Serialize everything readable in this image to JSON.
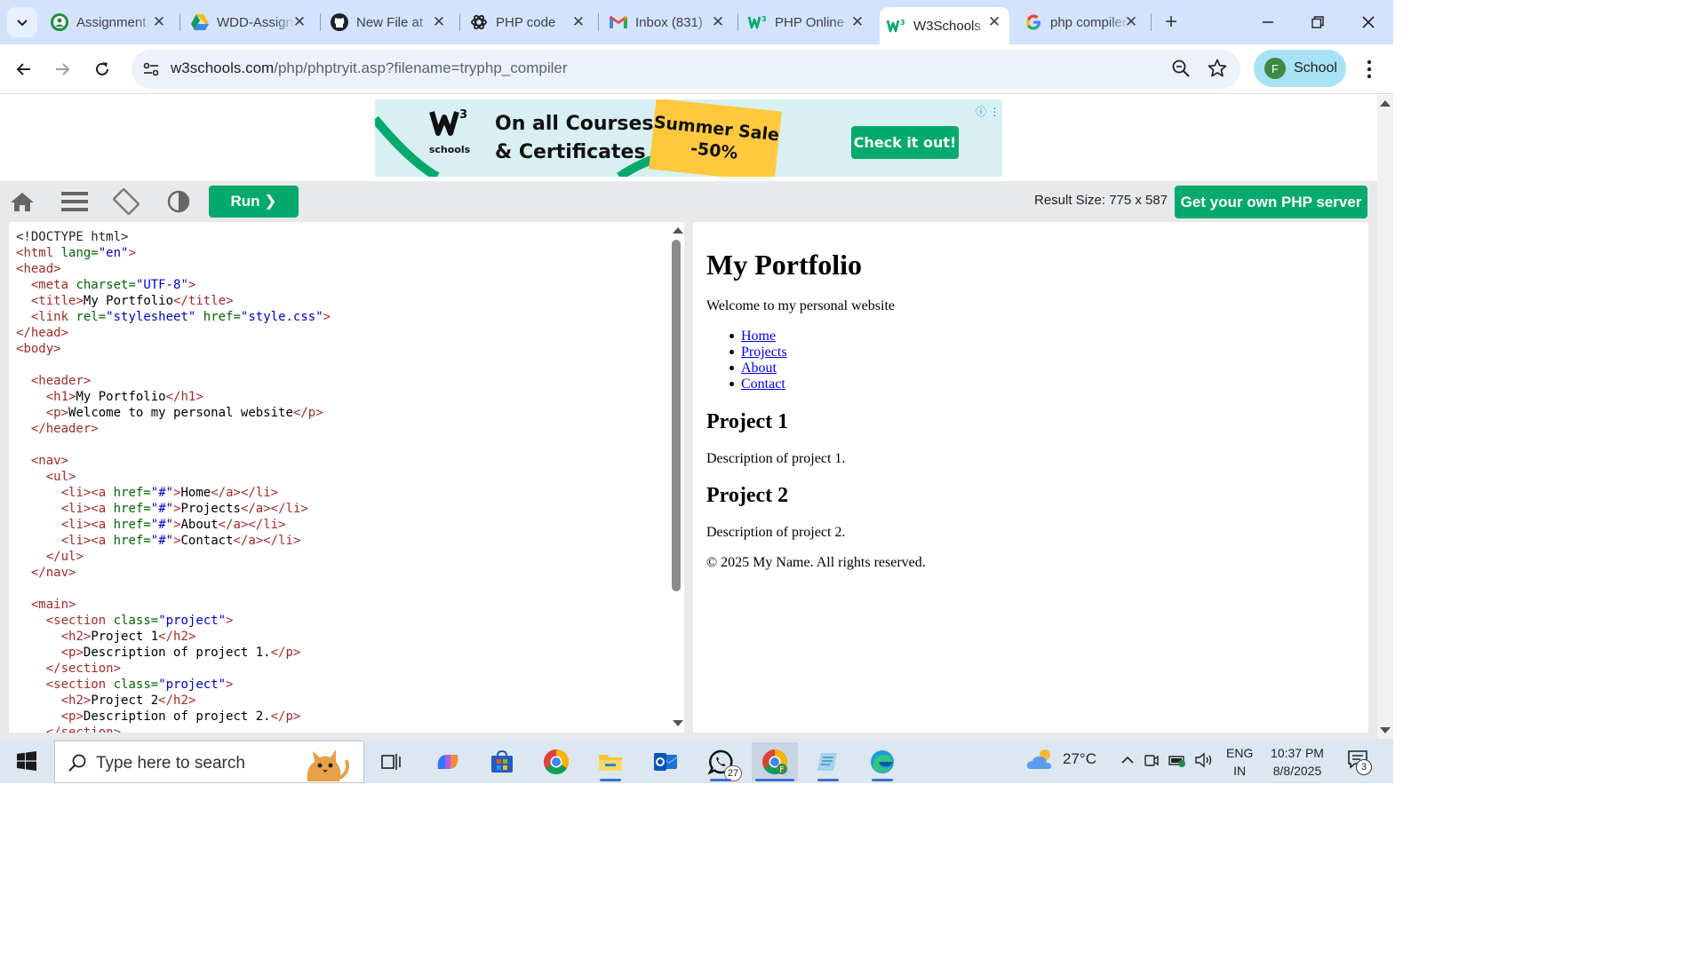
{
  "browser": {
    "tabs": [
      {
        "title": "Assignment",
        "icon": "classroom-icon"
      },
      {
        "title": "WDD-Assignment",
        "icon": "google-drive-icon"
      },
      {
        "title": "New File at",
        "icon": "github-icon"
      },
      {
        "title": "PHP code",
        "icon": "chatgpt-icon"
      },
      {
        "title": "Inbox (831)",
        "icon": "gmail-icon"
      },
      {
        "title": "PHP Online",
        "icon": "w3schools-icon"
      },
      {
        "title": "W3Schools",
        "icon": "w3schools-icon",
        "active": true
      },
      {
        "title": "php compiler",
        "icon": "google-icon"
      }
    ],
    "url_host": "w3schools.com",
    "url_path": "/php/phptryit.asp?filename=tryphp_compiler",
    "profile_initial": "F",
    "profile_name": "School"
  },
  "ad": {
    "logo_text": "schools",
    "logo_sup": "3",
    "headline_line1": "On all Courses",
    "headline_line2": "& Certificates",
    "sale_line1": "Summer Sale",
    "sale_line2": "-50%",
    "cta": "Check it out!"
  },
  "editor_toolbar": {
    "run_label": "Run ❯",
    "result_size": "Result Size: 775 x 587",
    "server_button": "Get your own PHP server"
  },
  "code_lines": [
    [
      [
        "doctype",
        "<!DOCTYPE html>"
      ]
    ],
    [
      [
        "bracket",
        "<"
      ],
      [
        "tag",
        "html"
      ],
      [
        "text",
        " "
      ],
      [
        "attr",
        "lang="
      ],
      [
        "str",
        "\"en\""
      ],
      [
        "bracket",
        ">"
      ]
    ],
    [
      [
        "bracket",
        "<"
      ],
      [
        "tag",
        "head"
      ],
      [
        "bracket",
        ">"
      ]
    ],
    [
      [
        "text",
        "  "
      ],
      [
        "bracket",
        "<"
      ],
      [
        "tag",
        "meta"
      ],
      [
        "text",
        " "
      ],
      [
        "attr",
        "charset="
      ],
      [
        "str",
        "\"UTF-8\""
      ],
      [
        "bracket",
        ">"
      ]
    ],
    [
      [
        "text",
        "  "
      ],
      [
        "bracket",
        "<"
      ],
      [
        "tag",
        "title"
      ],
      [
        "bracket",
        ">"
      ],
      [
        "text",
        "My Portfolio"
      ],
      [
        "bracket",
        "</"
      ],
      [
        "tag",
        "title"
      ],
      [
        "bracket",
        ">"
      ]
    ],
    [
      [
        "text",
        "  "
      ],
      [
        "bracket",
        "<"
      ],
      [
        "tag",
        "link"
      ],
      [
        "text",
        " "
      ],
      [
        "attr",
        "rel="
      ],
      [
        "str",
        "\"stylesheet\""
      ],
      [
        "text",
        " "
      ],
      [
        "attr",
        "href="
      ],
      [
        "str",
        "\"style.css\""
      ],
      [
        "bracket",
        ">"
      ]
    ],
    [
      [
        "bracket",
        "</"
      ],
      [
        "tag",
        "head"
      ],
      [
        "bracket",
        ">"
      ]
    ],
    [
      [
        "bracket",
        "<"
      ],
      [
        "tag",
        "body"
      ],
      [
        "bracket",
        ">"
      ]
    ],
    [],
    [
      [
        "text",
        "  "
      ],
      [
        "bracket",
        "<"
      ],
      [
        "tag",
        "header"
      ],
      [
        "bracket",
        ">"
      ]
    ],
    [
      [
        "text",
        "    "
      ],
      [
        "bracket",
        "<"
      ],
      [
        "tag",
        "h1"
      ],
      [
        "bracket",
        ">"
      ],
      [
        "text",
        "My Portfolio"
      ],
      [
        "bracket",
        "</"
      ],
      [
        "tag",
        "h1"
      ],
      [
        "bracket",
        ">"
      ]
    ],
    [
      [
        "text",
        "    "
      ],
      [
        "bracket",
        "<"
      ],
      [
        "tag",
        "p"
      ],
      [
        "bracket",
        ">"
      ],
      [
        "text",
        "Welcome to my personal website"
      ],
      [
        "bracket",
        "</"
      ],
      [
        "tag",
        "p"
      ],
      [
        "bracket",
        ">"
      ]
    ],
    [
      [
        "text",
        "  "
      ],
      [
        "bracket",
        "</"
      ],
      [
        "tag",
        "header"
      ],
      [
        "bracket",
        ">"
      ]
    ],
    [],
    [
      [
        "text",
        "  "
      ],
      [
        "bracket",
        "<"
      ],
      [
        "tag",
        "nav"
      ],
      [
        "bracket",
        ">"
      ]
    ],
    [
      [
        "text",
        "    "
      ],
      [
        "bracket",
        "<"
      ],
      [
        "tag",
        "ul"
      ],
      [
        "bracket",
        ">"
      ]
    ],
    [
      [
        "text",
        "      "
      ],
      [
        "bracket",
        "<"
      ],
      [
        "tag",
        "li"
      ],
      [
        "bracket",
        "><"
      ],
      [
        "tag",
        "a"
      ],
      [
        "text",
        " "
      ],
      [
        "attr",
        "href="
      ],
      [
        "str",
        "\"#\""
      ],
      [
        "bracket",
        ">"
      ],
      [
        "text",
        "Home"
      ],
      [
        "bracket",
        "</"
      ],
      [
        "tag",
        "a"
      ],
      [
        "bracket",
        "></"
      ],
      [
        "tag",
        "li"
      ],
      [
        "bracket",
        ">"
      ]
    ],
    [
      [
        "text",
        "      "
      ],
      [
        "bracket",
        "<"
      ],
      [
        "tag",
        "li"
      ],
      [
        "bracket",
        "><"
      ],
      [
        "tag",
        "a"
      ],
      [
        "text",
        " "
      ],
      [
        "attr",
        "href="
      ],
      [
        "str",
        "\"#\""
      ],
      [
        "bracket",
        ">"
      ],
      [
        "text",
        "Projects"
      ],
      [
        "bracket",
        "</"
      ],
      [
        "tag",
        "a"
      ],
      [
        "bracket",
        "></"
      ],
      [
        "tag",
        "li"
      ],
      [
        "bracket",
        ">"
      ]
    ],
    [
      [
        "text",
        "      "
      ],
      [
        "bracket",
        "<"
      ],
      [
        "tag",
        "li"
      ],
      [
        "bracket",
        "><"
      ],
      [
        "tag",
        "a"
      ],
      [
        "text",
        " "
      ],
      [
        "attr",
        "href="
      ],
      [
        "str",
        "\"#\""
      ],
      [
        "bracket",
        ">"
      ],
      [
        "text",
        "About"
      ],
      [
        "bracket",
        "</"
      ],
      [
        "tag",
        "a"
      ],
      [
        "bracket",
        "></"
      ],
      [
        "tag",
        "li"
      ],
      [
        "bracket",
        ">"
      ]
    ],
    [
      [
        "text",
        "      "
      ],
      [
        "bracket",
        "<"
      ],
      [
        "tag",
        "li"
      ],
      [
        "bracket",
        "><"
      ],
      [
        "tag",
        "a"
      ],
      [
        "text",
        " "
      ],
      [
        "attr",
        "href="
      ],
      [
        "str",
        "\"#\""
      ],
      [
        "bracket",
        ">"
      ],
      [
        "text",
        "Contact"
      ],
      [
        "bracket",
        "</"
      ],
      [
        "tag",
        "a"
      ],
      [
        "bracket",
        "></"
      ],
      [
        "tag",
        "li"
      ],
      [
        "bracket",
        ">"
      ]
    ],
    [
      [
        "text",
        "    "
      ],
      [
        "bracket",
        "</"
      ],
      [
        "tag",
        "ul"
      ],
      [
        "bracket",
        ">"
      ]
    ],
    [
      [
        "text",
        "  "
      ],
      [
        "bracket",
        "</"
      ],
      [
        "tag",
        "nav"
      ],
      [
        "bracket",
        ">"
      ]
    ],
    [],
    [
      [
        "text",
        "  "
      ],
      [
        "bracket",
        "<"
      ],
      [
        "tag",
        "main"
      ],
      [
        "bracket",
        ">"
      ]
    ],
    [
      [
        "text",
        "    "
      ],
      [
        "bracket",
        "<"
      ],
      [
        "tag",
        "section"
      ],
      [
        "text",
        " "
      ],
      [
        "attr",
        "class="
      ],
      [
        "str",
        "\"project\""
      ],
      [
        "bracket",
        ">"
      ]
    ],
    [
      [
        "text",
        "      "
      ],
      [
        "bracket",
        "<"
      ],
      [
        "tag",
        "h2"
      ],
      [
        "bracket",
        ">"
      ],
      [
        "text",
        "Project 1"
      ],
      [
        "bracket",
        "</"
      ],
      [
        "tag",
        "h2"
      ],
      [
        "bracket",
        ">"
      ]
    ],
    [
      [
        "text",
        "      "
      ],
      [
        "bracket",
        "<"
      ],
      [
        "tag",
        "p"
      ],
      [
        "bracket",
        ">"
      ],
      [
        "text",
        "Description of project 1."
      ],
      [
        "bracket",
        "</"
      ],
      [
        "tag",
        "p"
      ],
      [
        "bracket",
        ">"
      ]
    ],
    [
      [
        "text",
        "    "
      ],
      [
        "bracket",
        "</"
      ],
      [
        "tag",
        "section"
      ],
      [
        "bracket",
        ">"
      ]
    ],
    [
      [
        "text",
        "    "
      ],
      [
        "bracket",
        "<"
      ],
      [
        "tag",
        "section"
      ],
      [
        "text",
        " "
      ],
      [
        "attr",
        "class="
      ],
      [
        "str",
        "\"project\""
      ],
      [
        "bracket",
        ">"
      ]
    ],
    [
      [
        "text",
        "      "
      ],
      [
        "bracket",
        "<"
      ],
      [
        "tag",
        "h2"
      ],
      [
        "bracket",
        ">"
      ],
      [
        "text",
        "Project 2"
      ],
      [
        "bracket",
        "</"
      ],
      [
        "tag",
        "h2"
      ],
      [
        "bracket",
        ">"
      ]
    ],
    [
      [
        "text",
        "      "
      ],
      [
        "bracket",
        "<"
      ],
      [
        "tag",
        "p"
      ],
      [
        "bracket",
        ">"
      ],
      [
        "text",
        "Description of project 2."
      ],
      [
        "bracket",
        "</"
      ],
      [
        "tag",
        "p"
      ],
      [
        "bracket",
        ">"
      ]
    ],
    [
      [
        "text",
        "    "
      ],
      [
        "bracket",
        "</"
      ],
      [
        "tag",
        "section"
      ],
      [
        "bracket",
        ">"
      ]
    ]
  ],
  "result": {
    "h1": "My Portfolio",
    "tagline": "Welcome to my personal website",
    "nav": [
      "Home",
      "Projects",
      "About",
      "Contact"
    ],
    "project1_title": "Project 1",
    "project1_desc": "Description of project 1.",
    "project2_title": "Project 2",
    "project2_desc": "Description of project 2.",
    "footer": "© 2025 My Name. All rights reserved."
  },
  "taskbar": {
    "search_placeholder": "Type here to search",
    "whatsapp_badge": "27",
    "weather": "27°C",
    "lang_line1": "ENG",
    "lang_line2": "IN",
    "time": "10:37 PM",
    "date": "8/8/2025",
    "notification_count": "3"
  },
  "colors": {
    "w3_green": "#04aa6d",
    "tabstrip": "#d3e3fd",
    "profile_chip": "#a8e3f5",
    "taskbar": "#dce7f2"
  }
}
